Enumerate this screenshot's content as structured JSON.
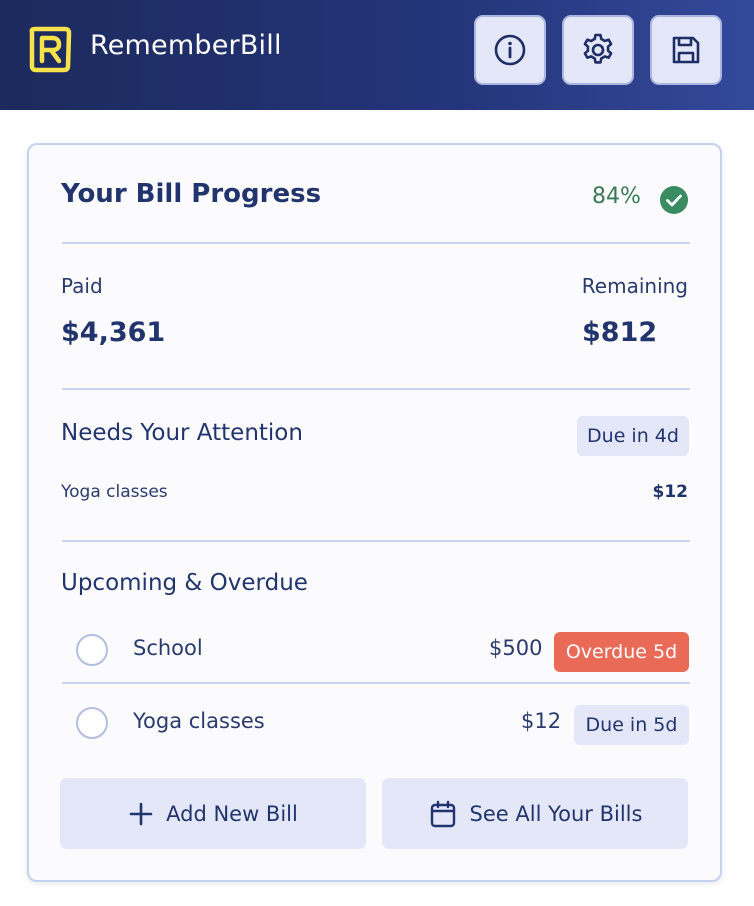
{
  "app": {
    "title": "RememberBill",
    "logo_letter": "R"
  },
  "header": {
    "buttons": [
      {
        "icon": "info-icon"
      },
      {
        "icon": "gear-icon"
      },
      {
        "icon": "save-icon"
      }
    ]
  },
  "progress": {
    "title": "Your Bill Progress",
    "percent_label": "84%",
    "percent": 84,
    "paid_label": "Paid",
    "paid_amount": "$4,361",
    "remaining_label": "Remaining",
    "remaining_amount": "$812"
  },
  "attention": {
    "title": "Needs Your Attention",
    "badge": "Due in 4d",
    "item": {
      "name": "Yoga classes",
      "amount": "$12"
    }
  },
  "upcoming": {
    "title": "Upcoming & Overdue",
    "items": [
      {
        "name": "School",
        "amount": "$500",
        "badge": "Overdue 5d",
        "status": "overdue"
      },
      {
        "name": "Yoga classes",
        "amount": "$12",
        "badge": "Due in 5d",
        "status": "due"
      }
    ]
  },
  "actions": {
    "add_label": "Add New Bill",
    "see_all_label": "See All Your Bills"
  },
  "colors": {
    "header_dark": "#1c2a5c",
    "accent_yellow": "#f6e24a",
    "success_green": "#3a8a62",
    "overdue_red": "#ea6a58",
    "badge_bg": "#e3e7f7"
  }
}
